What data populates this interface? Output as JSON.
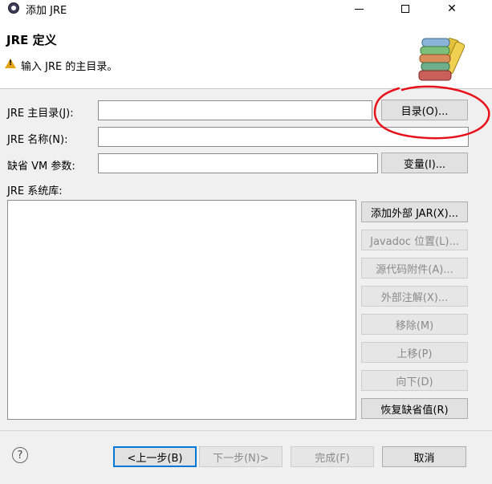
{
  "window": {
    "title": "添加 JRE",
    "minimize_glyph": "",
    "close_glyph": "✕"
  },
  "header": {
    "heading": "JRE 定义",
    "message": "输入 JRE 的主目录。",
    "icon": "books-icon"
  },
  "form": {
    "home_label": "JRE 主目录(J):",
    "home_value": "",
    "directory_button": "目录(O)...",
    "name_label": "JRE 名称(N):",
    "name_value": "",
    "vm_args_label": "缺省 VM 参数:",
    "vm_args_value": "",
    "variables_button": "变量(I)...",
    "libraries_label": "JRE 系统库:"
  },
  "library_buttons": {
    "add_external_jar": "添加外部 JAR(X)...",
    "javadoc_location": "Javadoc 位置(L)...",
    "source_attachment": "源代码附件(A)...",
    "external_annotations": "外部注解(X)...",
    "remove": "移除(M)",
    "move_up": "上移(P)",
    "move_down": "向下(D)",
    "restore_default": "恢复缺省值(R)"
  },
  "footer": {
    "help_glyph": "?",
    "back": "<上一步(B)",
    "next": "下一步(N)>",
    "finish": "完成(F)",
    "cancel": "取消"
  },
  "colors": {
    "warning": "#e7a417",
    "focus_border": "#0078d7",
    "annotation_red": "#e8101a"
  }
}
